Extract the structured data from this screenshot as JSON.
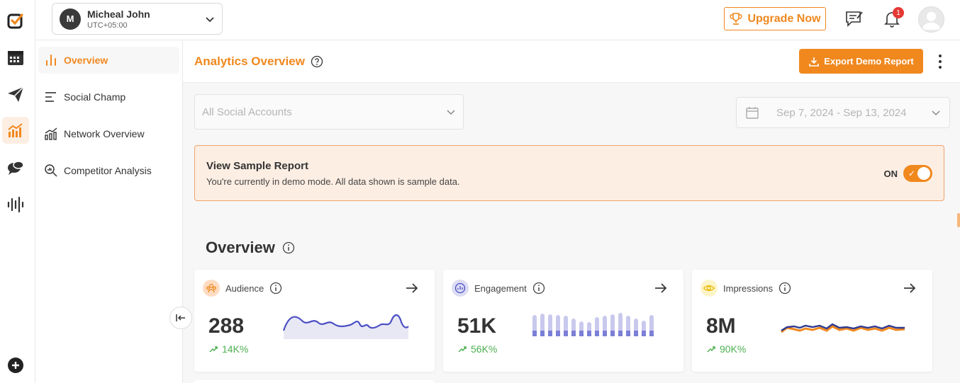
{
  "header": {
    "account_name": "Micheal John",
    "account_initial": "M",
    "account_timezone": "UTC+05:00",
    "upgrade_label": "Upgrade Now",
    "notification_count": "1"
  },
  "subnav": {
    "items": [
      {
        "label": "Overview",
        "icon": "bar-chart-icon",
        "active": true
      },
      {
        "label": "Social Champ",
        "icon": "lines-icon",
        "active": false
      },
      {
        "label": "Network Overview",
        "icon": "network-chart-icon",
        "active": false
      },
      {
        "label": "Competitor Analysis",
        "icon": "magnify-chart-icon",
        "active": false
      }
    ]
  },
  "main": {
    "title": "Analytics Overview",
    "export_label": "Export Demo Report",
    "accounts_placeholder": "All Social Accounts",
    "date_range": "Sep 7, 2024 - Sep 13, 2024",
    "banner": {
      "title": "View Sample Report",
      "description": "You're currently in demo mode. All data shown is sample data.",
      "toggle_label": "ON"
    },
    "section_title": "Overview",
    "cards": [
      {
        "label": "Audience",
        "value": "288",
        "change": "14K%",
        "icon": "audience-icon"
      },
      {
        "label": "Engagement",
        "value": "51K",
        "change": "56K%",
        "icon": "engagement-icon"
      },
      {
        "label": "Impressions",
        "value": "8M",
        "change": "90K%",
        "icon": "eye-icon"
      }
    ]
  },
  "colors": {
    "brand": "#f0881e",
    "positive": "#4caf50",
    "spark_blue": "#4b4fc4"
  }
}
